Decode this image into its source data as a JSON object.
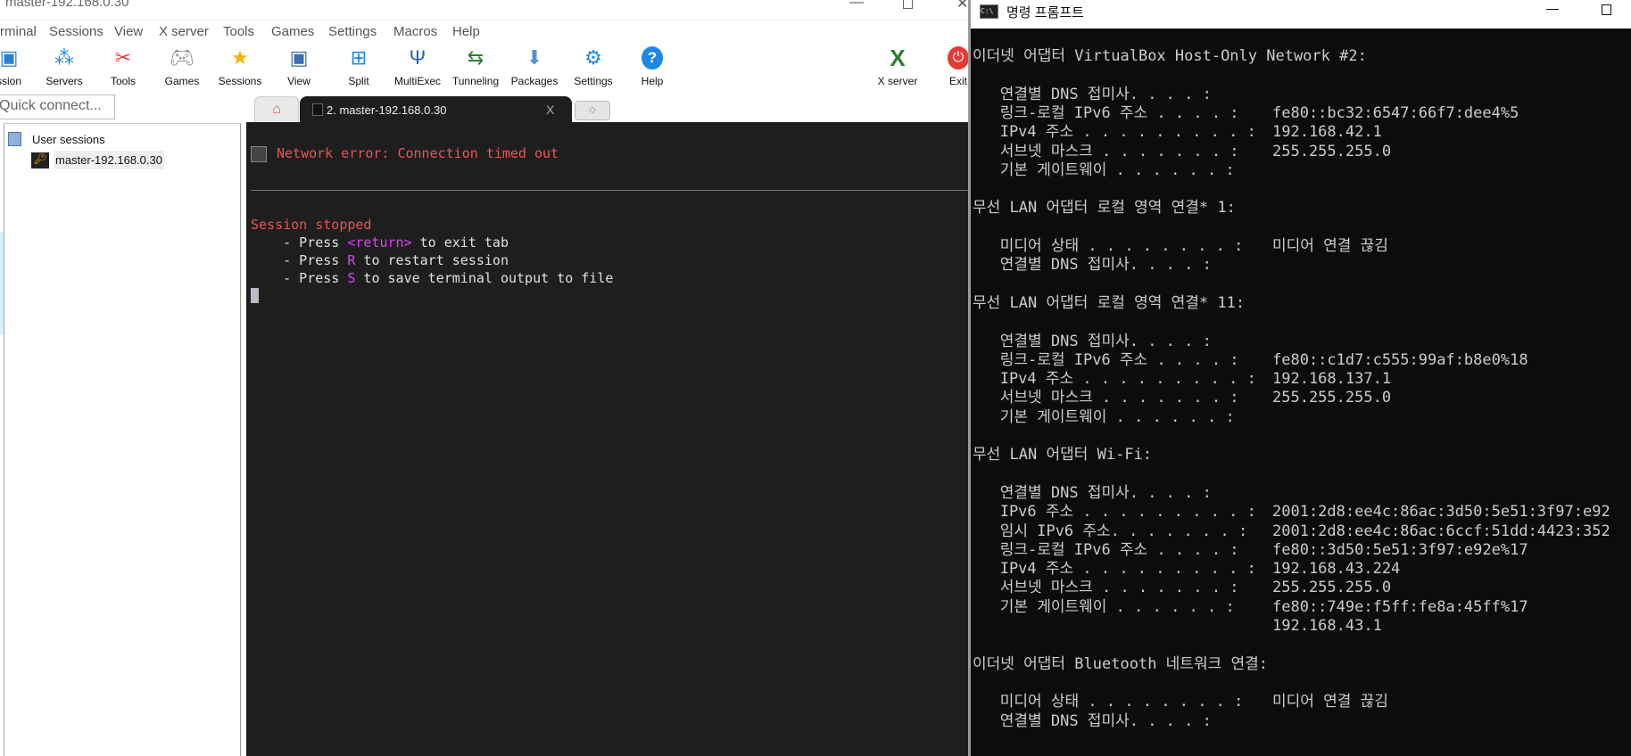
{
  "moba": {
    "title": "master-192.168.0.30",
    "menu": [
      "rminal",
      "Sessions",
      "View",
      "X server",
      "Tools",
      "Games",
      "Settings",
      "Macros",
      "Help"
    ],
    "toolbar": [
      {
        "label": "ssion",
        "icon": "session-icon"
      },
      {
        "label": "Servers",
        "icon": "servers-icon"
      },
      {
        "label": "Tools",
        "icon": "tools-icon"
      },
      {
        "label": "Games",
        "icon": "games-icon"
      },
      {
        "label": "Sessions",
        "icon": "star-icon"
      },
      {
        "label": "View",
        "icon": "view-icon"
      },
      {
        "label": "Split",
        "icon": "split-icon"
      },
      {
        "label": "MultiExec",
        "icon": "multiexec-icon"
      },
      {
        "label": "Tunneling",
        "icon": "tunneling-icon"
      },
      {
        "label": "Packages",
        "icon": "packages-icon"
      },
      {
        "label": "Settings",
        "icon": "gear-icon"
      },
      {
        "label": "Help",
        "icon": "help-icon"
      },
      {
        "label": "X server",
        "icon": "x-server-icon"
      },
      {
        "label": "Exit",
        "icon": "power-icon"
      }
    ],
    "quick_connect_placeholder": "Quick connect...",
    "tree": {
      "root": "User sessions",
      "session": "master-192.168.0.30"
    },
    "tabs": {
      "active": "2. master-192.168.0.30",
      "close": "X"
    },
    "terminal": {
      "error": "Network error: Connection timed out",
      "stopped": "Session stopped",
      "l1a": "    - Press ",
      "l1b": "<return>",
      "l1c": " to exit tab",
      "l2a": "    - Press ",
      "l2b": "R",
      "l2c": " to restart session",
      "l3a": "    - Press ",
      "l3b": "S",
      "l3c": " to save terminal output to file"
    }
  },
  "cmd": {
    "title": "명령 프롬프트",
    "lines": [
      {
        "k": "이더넷 어댑터 VirtualBox Host-Only Network #2:",
        "v": ""
      },
      {
        "k": "",
        "v": ""
      },
      {
        "k": "   연결별 DNS 접미사. . . . :",
        "v": ""
      },
      {
        "k": "   링크-로컬 IPv6 주소 . . . . :",
        "v": "fe80::bc32:6547:66f7:dee4%5"
      },
      {
        "k": "   IPv4 주소 . . . . . . . . . :",
        "v": "192.168.42.1"
      },
      {
        "k": "   서브넷 마스크 . . . . . . . :",
        "v": "255.255.255.0"
      },
      {
        "k": "   기본 게이트웨이 . . . . . . :",
        "v": ""
      },
      {
        "k": "",
        "v": ""
      },
      {
        "k": "무선 LAN 어댑터 로컬 영역 연결* 1:",
        "v": ""
      },
      {
        "k": "",
        "v": ""
      },
      {
        "k": "   미디어 상태 . . . . . . . . :",
        "v": "미디어 연결 끊김"
      },
      {
        "k": "   연결별 DNS 접미사. . . . :",
        "v": ""
      },
      {
        "k": "",
        "v": ""
      },
      {
        "k": "무선 LAN 어댑터 로컬 영역 연결* 11:",
        "v": ""
      },
      {
        "k": "",
        "v": ""
      },
      {
        "k": "   연결별 DNS 접미사. . . . :",
        "v": ""
      },
      {
        "k": "   링크-로컬 IPv6 주소 . . . . :",
        "v": "fe80::c1d7:c555:99af:b8e0%18"
      },
      {
        "k": "   IPv4 주소 . . . . . . . . . :",
        "v": "192.168.137.1"
      },
      {
        "k": "   서브넷 마스크 . . . . . . . :",
        "v": "255.255.255.0"
      },
      {
        "k": "   기본 게이트웨이 . . . . . . :",
        "v": ""
      },
      {
        "k": "",
        "v": ""
      },
      {
        "k": "무선 LAN 어댑터 Wi-Fi:",
        "v": ""
      },
      {
        "k": "",
        "v": ""
      },
      {
        "k": "   연결별 DNS 접미사. . . . :",
        "v": ""
      },
      {
        "k": "   IPv6 주소 . . . . . . . . . :",
        "v": "2001:2d8:ee4c:86ac:3d50:5e51:3f97:e92"
      },
      {
        "k": "   임시 IPv6 주소. . . . . . . :",
        "v": "2001:2d8:ee4c:86ac:6ccf:51dd:4423:352"
      },
      {
        "k": "   링크-로컬 IPv6 주소 . . . . :",
        "v": "fe80::3d50:5e51:3f97:e92e%17"
      },
      {
        "k": "   IPv4 주소 . . . . . . . . . :",
        "v": "192.168.43.224"
      },
      {
        "k": "   서브넷 마스크 . . . . . . . :",
        "v": "255.255.255.0"
      },
      {
        "k": "   기본 게이트웨이 . . . . . . :",
        "v": "fe80::749e:f5ff:fe8a:45ff%17"
      },
      {
        "k": "",
        "v": "192.168.43.1"
      },
      {
        "k": "",
        "v": ""
      },
      {
        "k": "이더넷 어댑터 Bluetooth 네트워크 연결:",
        "v": ""
      },
      {
        "k": "",
        "v": ""
      },
      {
        "k": "   미디어 상태 . . . . . . . . :",
        "v": "미디어 연결 끊김"
      },
      {
        "k": "   연결별 DNS 접미사. . . . :",
        "v": ""
      }
    ]
  }
}
